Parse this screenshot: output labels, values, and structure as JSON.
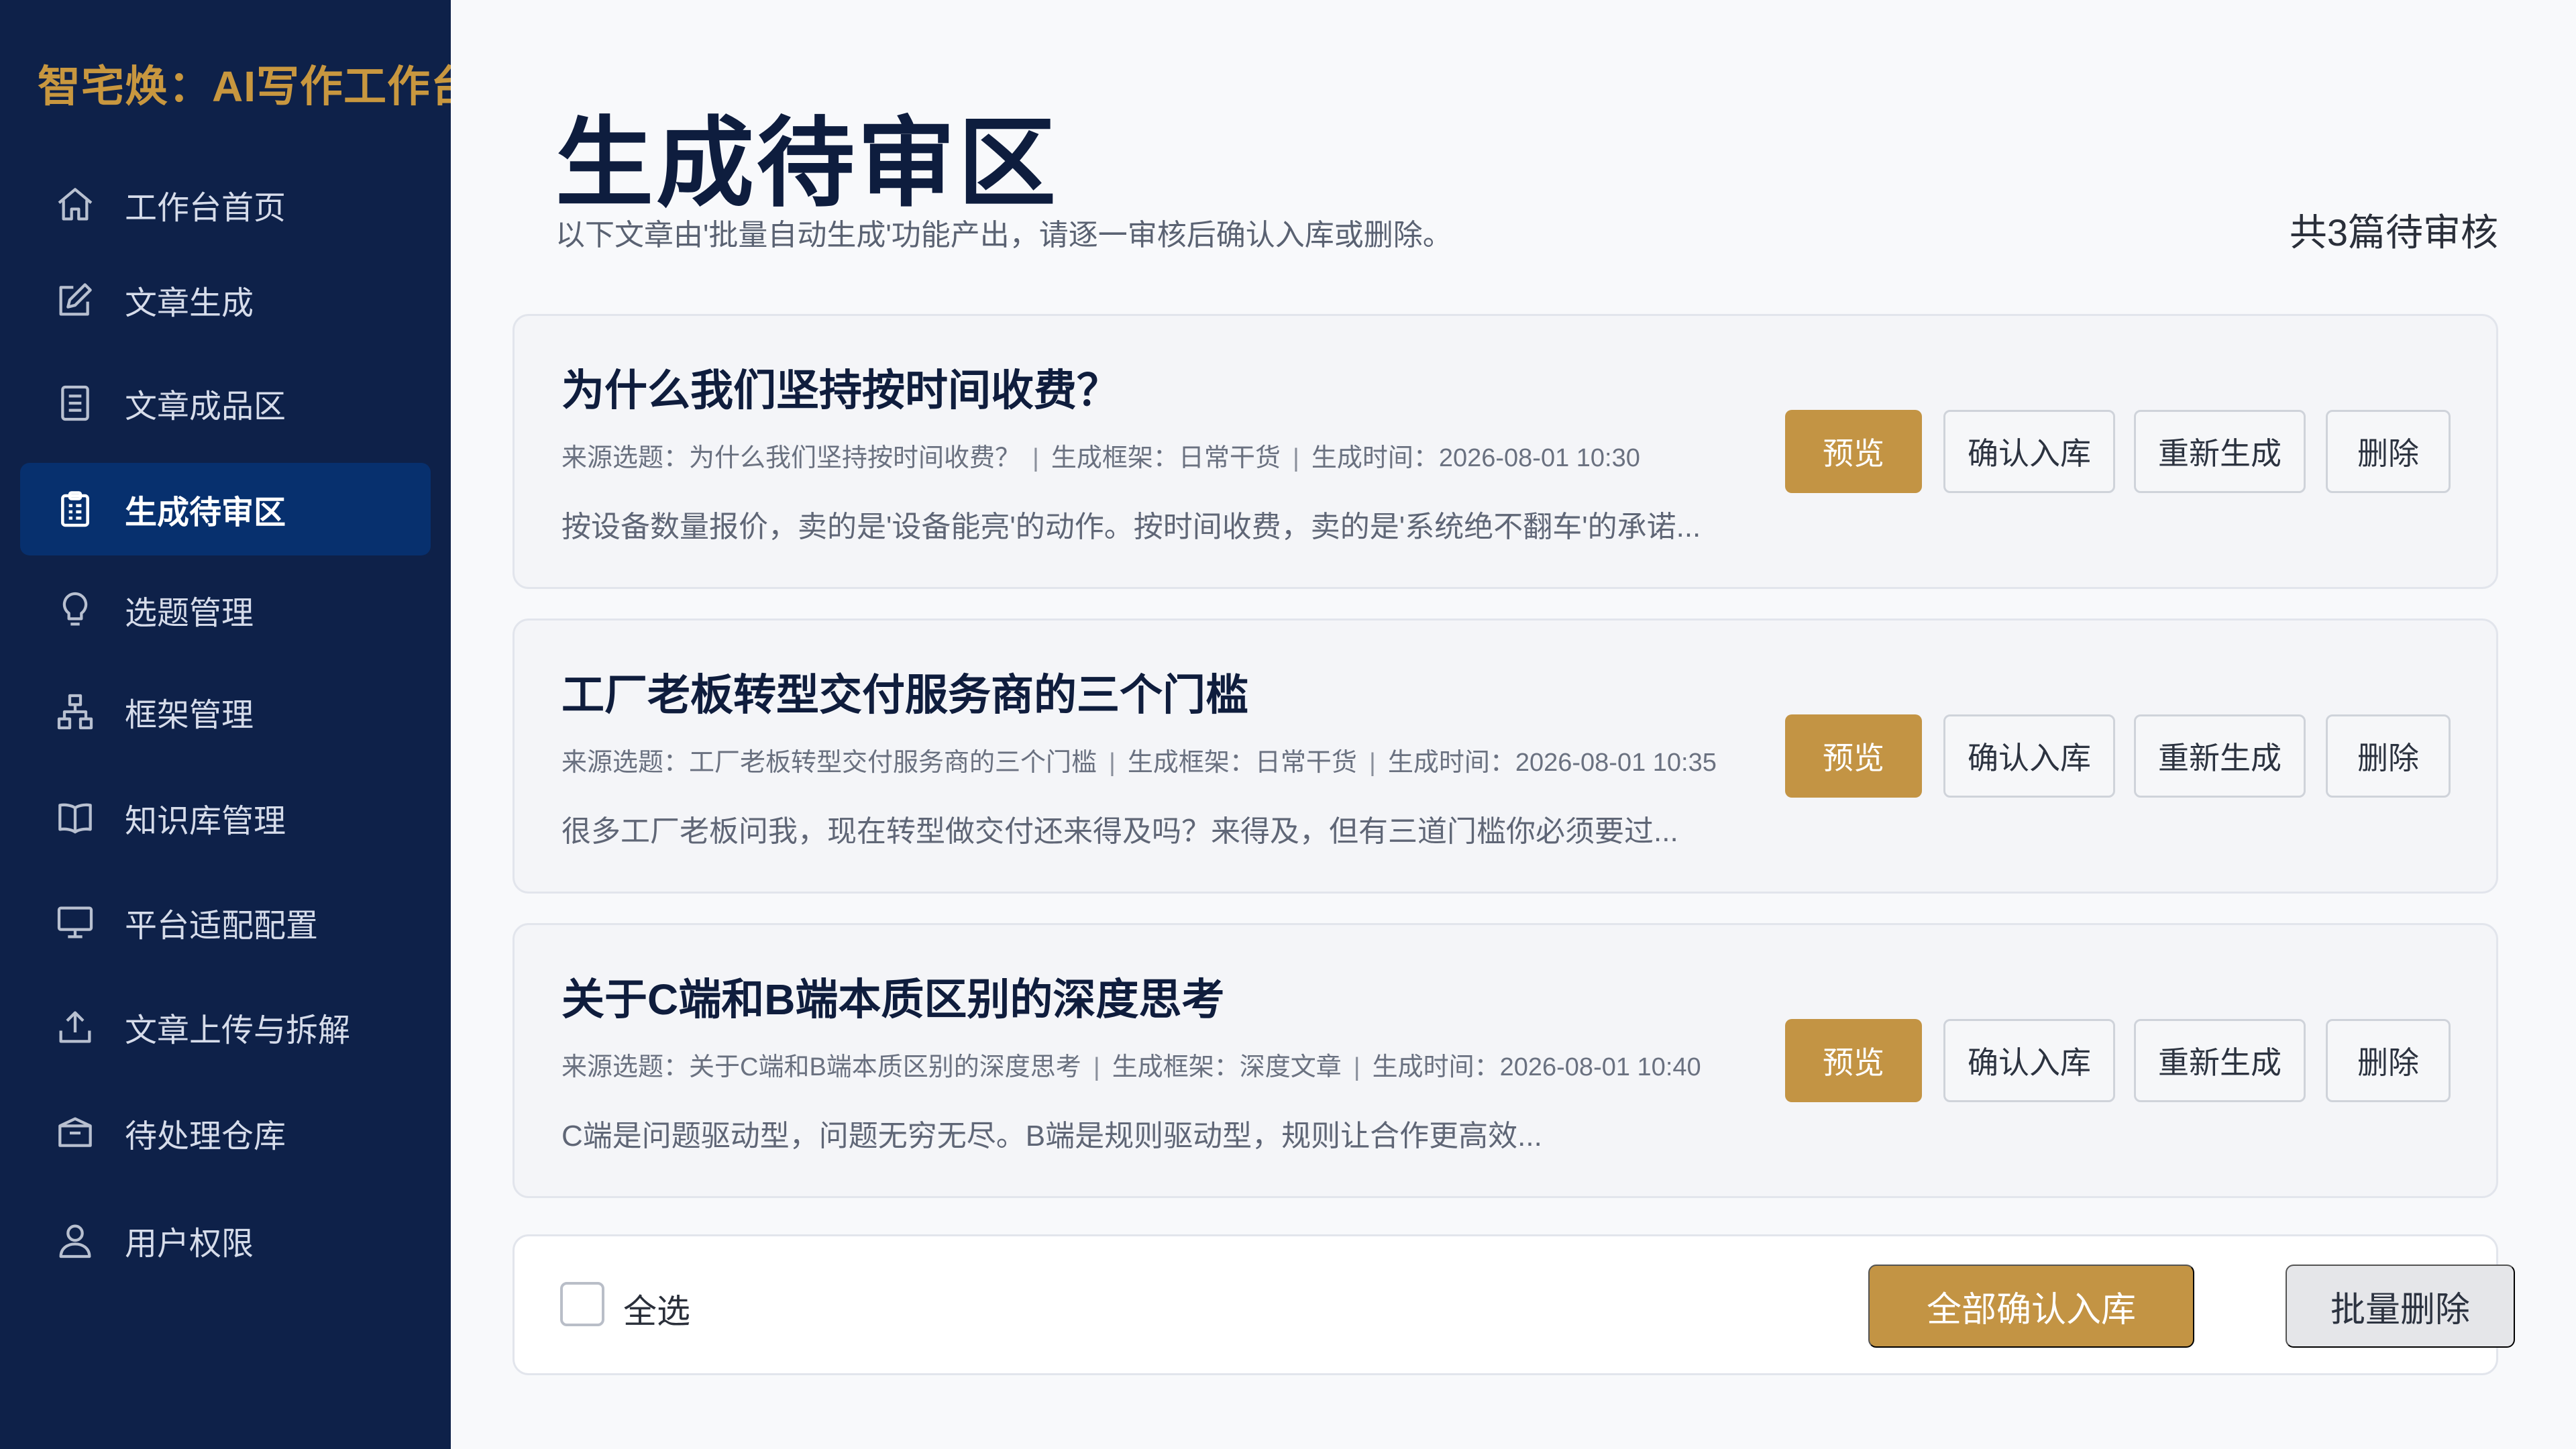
{
  "app": {
    "brand": "智宅焕：AI写作工作台"
  },
  "sidebar": {
    "items": [
      {
        "label": "工作台首页",
        "icon": "home-icon",
        "active": false
      },
      {
        "label": "文章生成",
        "icon": "edit-icon",
        "active": false
      },
      {
        "label": "文章成品区",
        "icon": "document-icon",
        "active": false
      },
      {
        "label": "生成待审区",
        "icon": "clipboard-icon",
        "active": true
      },
      {
        "label": "选题管理",
        "icon": "lightbulb-icon",
        "active": false
      },
      {
        "label": "框架管理",
        "icon": "hierarchy-icon",
        "active": false
      },
      {
        "label": "知识库管理",
        "icon": "book-icon",
        "active": false
      },
      {
        "label": "平台适配配置",
        "icon": "monitor-icon",
        "active": false
      },
      {
        "label": "文章上传与拆解",
        "icon": "upload-icon",
        "active": false
      },
      {
        "label": "待处理仓库",
        "icon": "box-icon",
        "active": false
      },
      {
        "label": "用户权限",
        "icon": "user-icon",
        "active": false
      }
    ]
  },
  "header": {
    "title": "生成待审区",
    "subtitle": "以下文章由'批量自动生成'功能产出，请逐一审核后确认入库或删除。",
    "pending_count": "共3篇待审核"
  },
  "articles": [
    {
      "title": "为什么我们坚持按时间收费？",
      "source_label": "来源选题：",
      "source_value": "为什么我们坚持按时间收费？",
      "framework_label": "生成框架：",
      "framework_value": "日常干货",
      "time_label": "生成时间：",
      "time_value": "2026-08-01 10:30",
      "excerpt": "按设备数量报价，卖的是'设备能亮'的动作。按时间收费，卖的是'系统绝不翻车'的承诺..."
    },
    {
      "title": "工厂老板转型交付服务商的三个门槛",
      "source_label": "来源选题：",
      "source_value": "工厂老板转型交付服务商的三个门槛",
      "framework_label": "生成框架：",
      "framework_value": "日常干货",
      "time_label": "生成时间：",
      "time_value": "2026-08-01 10:35",
      "excerpt": "很多工厂老板问我，现在转型做交付还来得及吗？来得及，但有三道门槛你必须要过..."
    },
    {
      "title": "关于C端和B端本质区别的深度思考",
      "source_label": "来源选题：",
      "source_value": "关于C端和B端本质区别的深度思考",
      "framework_label": "生成框架：",
      "framework_value": "深度文章",
      "time_label": "生成时间：",
      "time_value": "2026-08-01 10:40",
      "excerpt": "C端是问题驱动型，问题无穷无尽。B端是规则驱动型，规则让合作更高效..."
    }
  ],
  "card_actions": {
    "preview": "预览",
    "confirm": "确认入库",
    "regenerate": "重新生成",
    "delete": "删除"
  },
  "footer": {
    "select_all": "全选",
    "confirm_all": "全部确认入库",
    "bulk_delete": "批量删除"
  },
  "colors": {
    "sidebar_bg": "#0e2149",
    "sidebar_active": "#07306e",
    "accent_gold": "#c39444",
    "brand_gold": "#c8973f",
    "title_navy": "#0e1d3e"
  }
}
